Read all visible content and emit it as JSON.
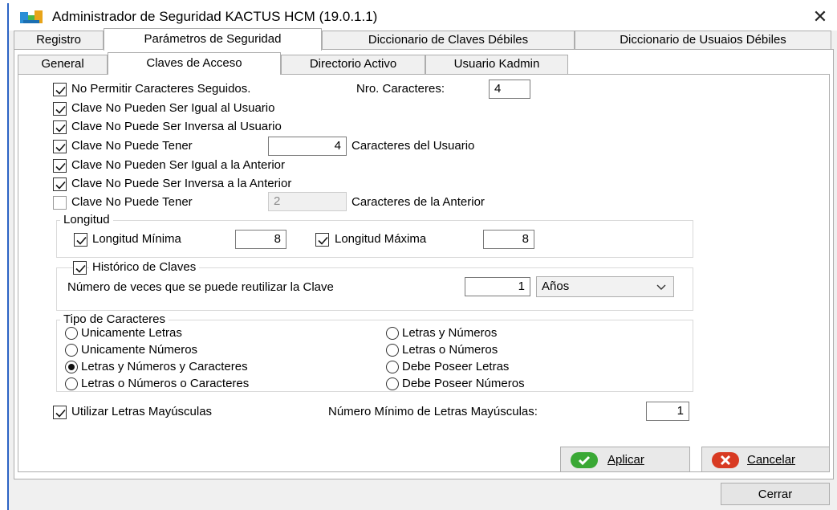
{
  "window": {
    "title": "Administrador de Seguridad KACTUS HCM (19.0.1.1)",
    "close_glyph": "✕"
  },
  "tabs_top": [
    {
      "label": "Registro"
    },
    {
      "label": "Parámetros de Seguridad"
    },
    {
      "label": "Diccionario de Claves Débiles"
    },
    {
      "label": "Diccionario de Usuaios Débiles"
    }
  ],
  "tabs_sub": [
    {
      "label": "General"
    },
    {
      "label": "Claves de Acceso"
    },
    {
      "label": "Directorio Activo"
    },
    {
      "label": "Usuario Kadmin"
    }
  ],
  "options": {
    "no_seguidos": {
      "label": "No Permitir Caracteres Seguidos.",
      "checked": true
    },
    "nro_caracteres": {
      "label": "Nro. Caracteres:",
      "value": "4"
    },
    "igual_usuario": {
      "label": "Clave No Pueden Ser Igual al Usuario",
      "checked": true
    },
    "inversa_usuario": {
      "label": "Clave No Puede Ser Inversa al Usuario",
      "checked": true
    },
    "tener_usuario": {
      "label": "Clave No Puede Tener",
      "checked": true,
      "value": "4",
      "suffix": "Caracteres del Usuario"
    },
    "igual_anterior": {
      "label": "Clave No Pueden Ser Igual a la Anterior",
      "checked": true
    },
    "inversa_anterior": {
      "label": "Clave No Puede Ser Inversa a la Anterior",
      "checked": true
    },
    "tener_anterior": {
      "label": "Clave No Puede Tener",
      "checked": false,
      "value": "2",
      "suffix": "Caracteres de la Anterior"
    }
  },
  "longitud": {
    "legend": "Longitud",
    "minima": {
      "label": "Longitud Mínima",
      "checked": true,
      "value": "8"
    },
    "maxima": {
      "label": "Longitud Máxima",
      "checked": true,
      "value": "8"
    }
  },
  "historico": {
    "label": "Histórico de Claves",
    "checked": true,
    "reuse_label": "Número de veces que se puede reutilizar la Clave",
    "reuse_value": "1",
    "period": "Años"
  },
  "tipo": {
    "legend": "Tipo de Caracteres",
    "options": [
      {
        "label": "Unicamente Letras",
        "selected": false
      },
      {
        "label": "Unicamente Números",
        "selected": false
      },
      {
        "label": "Letras y Números y Caracteres",
        "selected": true
      },
      {
        "label": "Letras o Números o Caracteres",
        "selected": false
      },
      {
        "label": "Letras y Números",
        "selected": false
      },
      {
        "label": "Letras o Números",
        "selected": false
      },
      {
        "label": "Debe Poseer Letras",
        "selected": false
      },
      {
        "label": "Debe Poseer Números",
        "selected": false
      }
    ]
  },
  "mayusculas": {
    "label": "Utilizar Letras Mayúsculas",
    "checked": true,
    "min_label": "Número Mínimo de Letras Mayúsculas:",
    "min_value": "1"
  },
  "buttons": {
    "aplicar": "Aplicar",
    "cancelar": "Cancelar",
    "cerrar": "Cerrar"
  },
  "colors": {
    "window_border": "#2b63c4",
    "apply_icon": "#3aa835",
    "cancel_icon": "#d83a22"
  }
}
